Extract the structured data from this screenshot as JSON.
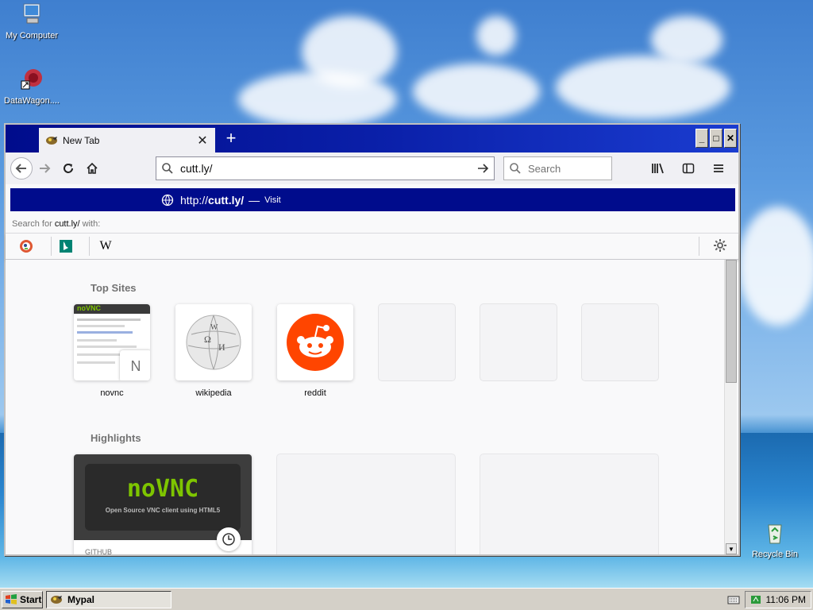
{
  "desktop": {
    "icons": [
      {
        "label": "My Computer",
        "icon": "computer-icon"
      },
      {
        "label": "DataWagon....",
        "icon": "datawagon-icon"
      },
      {
        "label": "Recycle Bin",
        "icon": "recycle-bin-icon"
      }
    ]
  },
  "browser": {
    "tab": {
      "title": "New Tab",
      "close": "✕"
    },
    "new_tab": "+",
    "window_buttons": {
      "minimize": "_",
      "maximize": "□",
      "close": "✕"
    },
    "url": {
      "value": "cutt.ly/"
    },
    "search": {
      "placeholder": "Search"
    },
    "suggestion": {
      "url_prefix": "http://",
      "url_host": "cutt.ly/",
      "separator": "—",
      "action": "Visit"
    },
    "search_with": {
      "prefix": "Search for ",
      "query": "cutt.ly/",
      "suffix": " with:"
    },
    "engines": [
      {
        "name": "duckduckgo",
        "glyph": "◉"
      },
      {
        "name": "bing",
        "glyph": "b"
      },
      {
        "name": "wikipedia",
        "glyph": "W"
      }
    ]
  },
  "newtab": {
    "top_sites_title": "Top Sites",
    "top_sites": [
      {
        "label": "novnc",
        "badge": "N"
      },
      {
        "label": "wikipedia"
      },
      {
        "label": "reddit"
      },
      {
        "label": ""
      },
      {
        "label": ""
      },
      {
        "label": ""
      }
    ],
    "highlights_title": "Highlights",
    "highlights": [
      {
        "logo": "noVNC",
        "tagline": "Open Source VNC client using HTML5",
        "source": "GITHUB"
      }
    ]
  },
  "taskbar": {
    "start": "Start",
    "item": "Mypal",
    "clock": "11:06 PM"
  },
  "colors": {
    "titlebar": "#000c8c",
    "reddit": "#ff4500",
    "novnc_green": "#7ec500",
    "novnc_yellow": "#ffe600"
  }
}
